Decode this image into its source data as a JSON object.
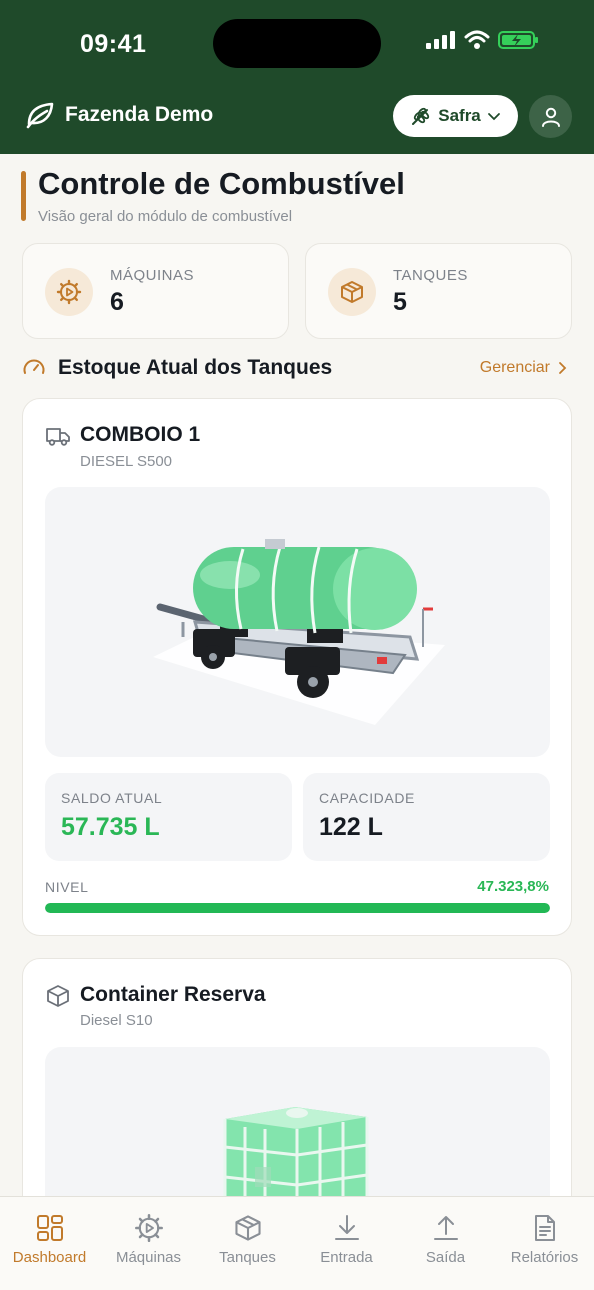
{
  "status_bar": {
    "time": "09:41"
  },
  "header": {
    "farm_name": "Fazenda Demo",
    "safra_label": "Safra"
  },
  "page": {
    "title": "Controle de Combustível",
    "subtitle": "Visão geral do módulo de combustível"
  },
  "stats": [
    {
      "label": "MÁQUINAS",
      "value": "6",
      "icon": "gear-icon"
    },
    {
      "label": "TANQUES",
      "value": "5",
      "icon": "box-icon"
    }
  ],
  "section": {
    "title": "Estoque Atual dos Tanques",
    "manage_label": "Gerenciar"
  },
  "tanks": [
    {
      "name": "COMBOIO 1",
      "fuel": "DIESEL S500",
      "icon": "truck-icon",
      "balance_label": "SALDO ATUAL",
      "balance": "57.735 L",
      "capacity_label": "CAPACIDADE",
      "capacity": "122 L",
      "level_label": "NIVEL",
      "level_text": "47.323,8%",
      "level_fill_fraction": 1.0
    },
    {
      "name": "Container Reserva",
      "fuel": "Diesel S10",
      "icon": "box-icon"
    }
  ],
  "tabs": [
    {
      "label": "Dashboard",
      "icon": "dashboard-icon",
      "active": true
    },
    {
      "label": "Máquinas",
      "icon": "gear-icon"
    },
    {
      "label": "Tanques",
      "icon": "box-icon"
    },
    {
      "label": "Entrada",
      "icon": "download-icon"
    },
    {
      "label": "Saída",
      "icon": "upload-icon"
    },
    {
      "label": "Relatórios",
      "icon": "report-icon"
    }
  ],
  "colors": {
    "header_bg": "#1f4a2a",
    "accent": "#c17a2b",
    "success": "#22b855",
    "tank_green": "#5fd08f"
  }
}
